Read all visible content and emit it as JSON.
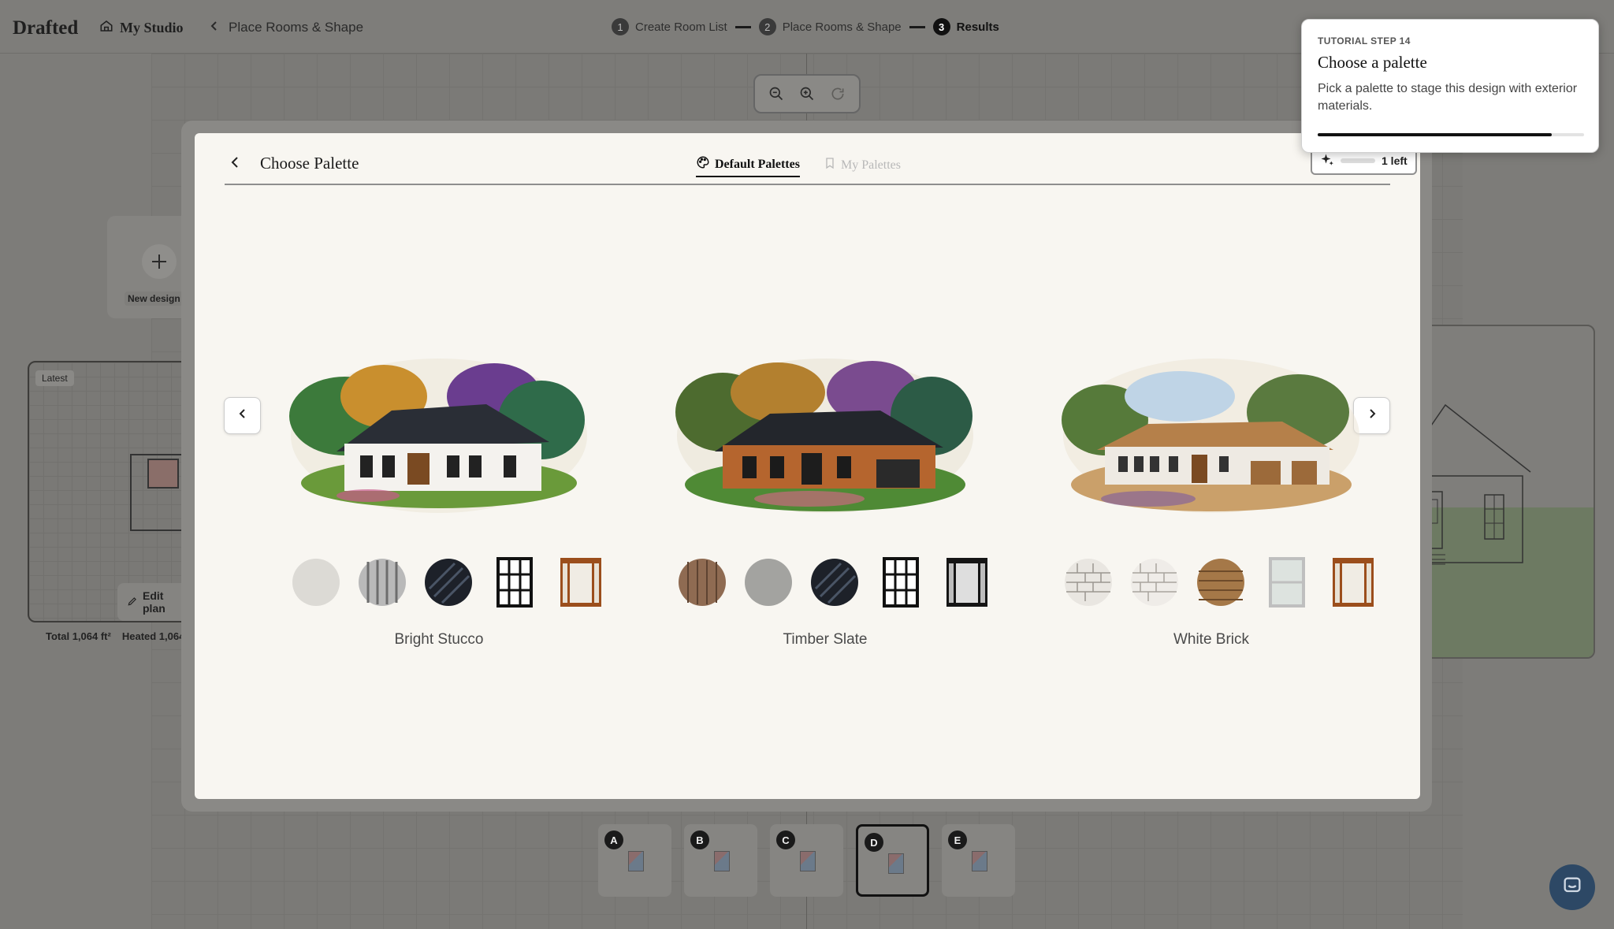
{
  "app": {
    "logo": "Drafted",
    "studio_link": "My Studio",
    "breadcrumb": "Place Rooms & Shape"
  },
  "steps": [
    {
      "num": "1",
      "label": "Create Room List"
    },
    {
      "num": "2",
      "label": "Place Rooms & Shape"
    },
    {
      "num": "3",
      "label": "Results"
    }
  ],
  "sidebar": {
    "new_design_label": "New design",
    "latest_tag": "Latest",
    "edit_plan_label": "Edit plan",
    "total": "Total 1,064 ft²",
    "heated": "Heated 1,064"
  },
  "design_thumbs": [
    {
      "letter": "A"
    },
    {
      "letter": "B"
    },
    {
      "letter": "C"
    },
    {
      "letter": "D",
      "selected": true
    },
    {
      "letter": "E"
    }
  ],
  "modal": {
    "title": "Choose Palette",
    "tabs": [
      {
        "label": "Default Palettes",
        "active": true
      },
      {
        "label": "My Palettes",
        "active": false
      }
    ],
    "credits": {
      "label": "1 left",
      "remaining": 1
    }
  },
  "palettes": [
    {
      "name": "Bright Stucco",
      "swatches": [
        "stucco-white",
        "siding-gray",
        "roof-black-metal",
        "window-black-grid",
        "door-wood-glass"
      ]
    },
    {
      "name": "Timber Slate",
      "swatches": [
        "wood-cedar",
        "stucco-gray",
        "roof-black-metal",
        "window-black-grid",
        "door-black-glass"
      ]
    },
    {
      "name": "White Brick",
      "swatches": [
        "brick-white",
        "brick-white-light",
        "shingle-brown",
        "window-white",
        "door-wood-glass"
      ]
    }
  ],
  "tutorial": {
    "step": "TUTORIAL STEP 14",
    "title": "Choose a palette",
    "body": "Pick a palette to stage this design with exterior materials.",
    "progress": 0.88
  },
  "colors": {
    "accent": "#111111",
    "modal_bg": "#f8f6f1",
    "overlay": "#7d7c79"
  }
}
